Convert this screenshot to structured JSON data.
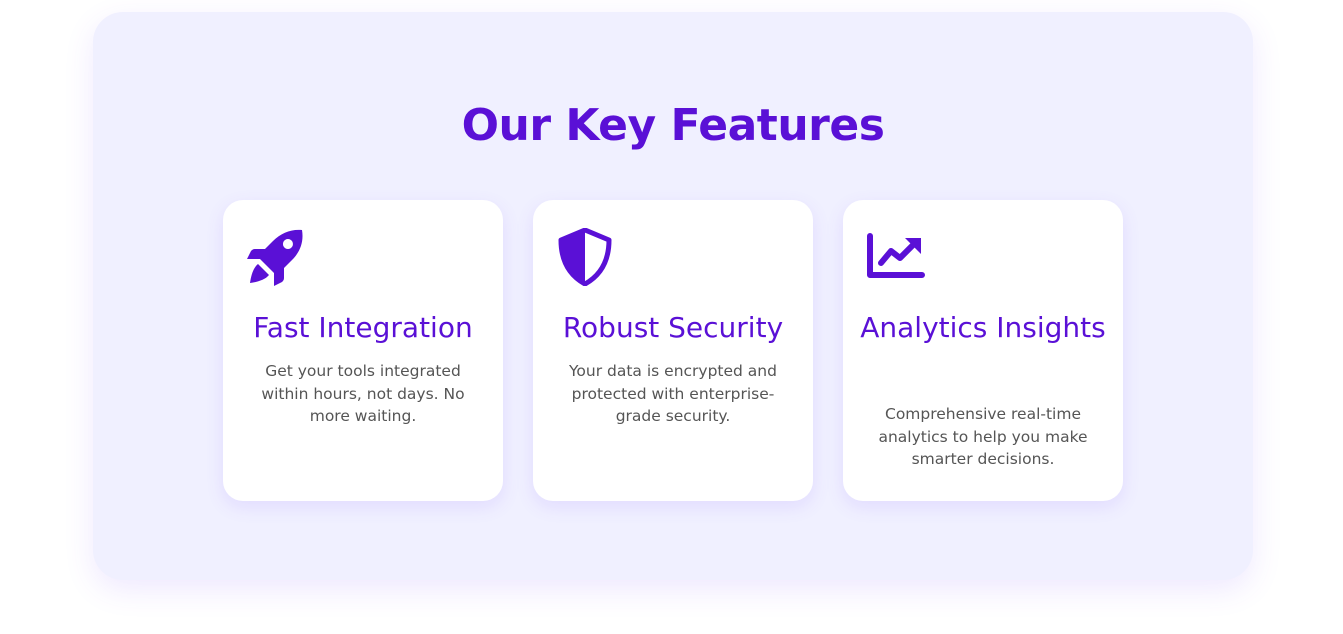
{
  "section": {
    "title": "Our Key Features"
  },
  "colors": {
    "accent": "#5a10d6",
    "panel_bg": "#f0f0ff",
    "card_bg": "#ffffff",
    "text_muted": "#555555"
  },
  "features": [
    {
      "icon": "rocket-icon",
      "title": "Fast Integration",
      "description": "Get your tools integrated within hours, not days. No more waiting."
    },
    {
      "icon": "shield-icon",
      "title": "Robust Security",
      "description": "Your data is encrypted and protected with enterprise-grade security."
    },
    {
      "icon": "chart-line-icon",
      "title": "Analytics Insights",
      "description": "Comprehensive real-time analytics to help you make smarter decisions."
    }
  ]
}
